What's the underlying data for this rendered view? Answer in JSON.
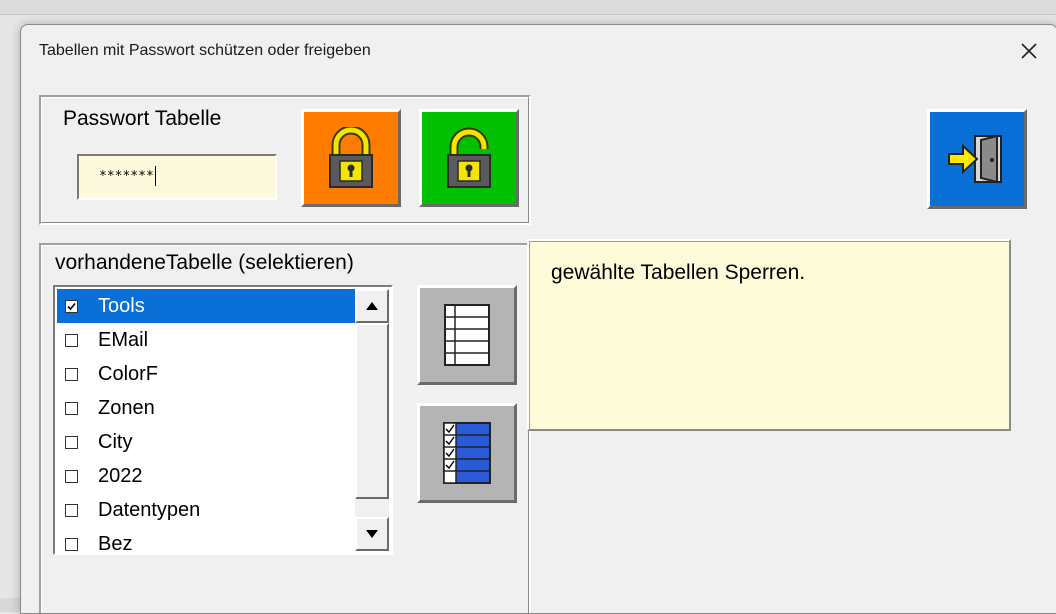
{
  "window": {
    "title": "Tabellen  mit Passwort schützen oder freigeben",
    "close_icon": "close-icon"
  },
  "password_section": {
    "label": "Passwort Tabelle",
    "input_value": "*******",
    "lock_button": {
      "icon": "padlock-closed-icon",
      "color": "#ff7c00"
    },
    "unlock_button": {
      "icon": "padlock-open-icon",
      "color": "#00c000"
    }
  },
  "exit_button": {
    "icon": "exit-door-icon",
    "color": "#0a6fd6"
  },
  "sheets_section": {
    "label": "vorhandeneTabelle (selektieren)",
    "items": [
      {
        "label": "Tools",
        "checked": true,
        "selected": true
      },
      {
        "label": "EMail",
        "checked": false,
        "selected": false
      },
      {
        "label": "ColorF",
        "checked": false,
        "selected": false
      },
      {
        "label": "Zonen",
        "checked": false,
        "selected": false
      },
      {
        "label": "City",
        "checked": false,
        "selected": false
      },
      {
        "label": "2022",
        "checked": false,
        "selected": false
      },
      {
        "label": "Datentypen",
        "checked": false,
        "selected": false
      },
      {
        "label": "Bez",
        "checked": false,
        "selected": false
      }
    ],
    "deselect_all_button": {
      "icon": "empty-table-icon"
    },
    "select_all_button": {
      "icon": "checked-table-icon",
      "color": "#2a5bd7"
    }
  },
  "info": {
    "text": "gewählte Tabellen Sperren.",
    "color": "#fefcd8"
  },
  "colors": {
    "selection": "#0a6fd6",
    "dialog_bg": "#f0f0f0",
    "input_bg": "#fcf9dc"
  }
}
